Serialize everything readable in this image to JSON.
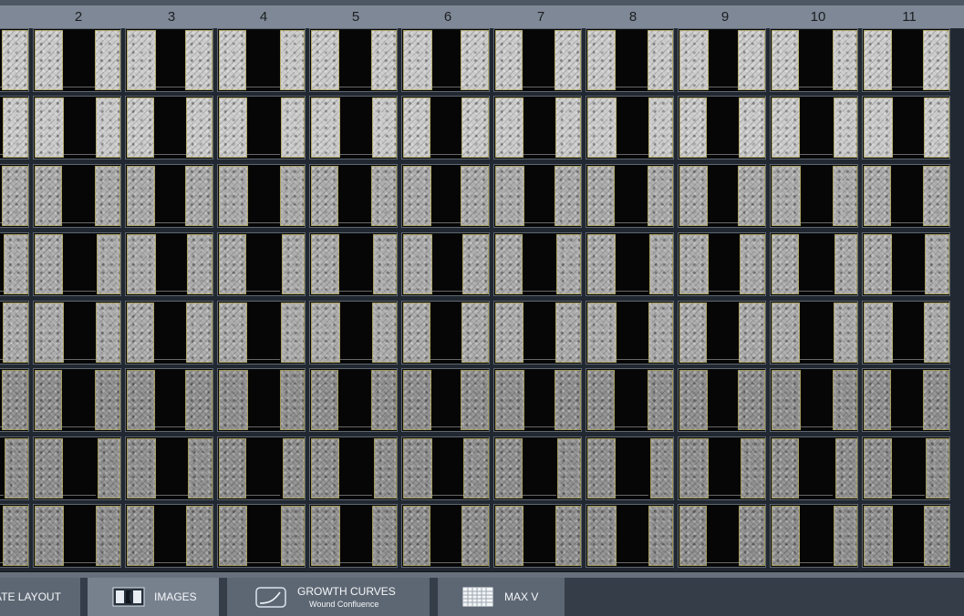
{
  "column_labels": [
    "2",
    "3",
    "4",
    "5",
    "6",
    "7",
    "8",
    "9",
    "10",
    "11"
  ],
  "bottom_tabs": {
    "plate_layout": {
      "label": "ATE LAYOUT",
      "icon": ""
    },
    "images": {
      "label": "IMAGES",
      "icon": "images-icon"
    },
    "growth_curves": {
      "label": "GROWTH CURVES",
      "sublabel": "Wound Confluence",
      "icon": "growth-curve-icon"
    },
    "max_v": {
      "label": "MAX V",
      "icon": "table-grid-icon"
    }
  },
  "colors": {
    "header_background": "#7f8896",
    "bottom_bar_background": "#343d48",
    "active_tab": "#77818e",
    "well_border": "#5e6770",
    "wound_outline": "#aa9c41"
  }
}
